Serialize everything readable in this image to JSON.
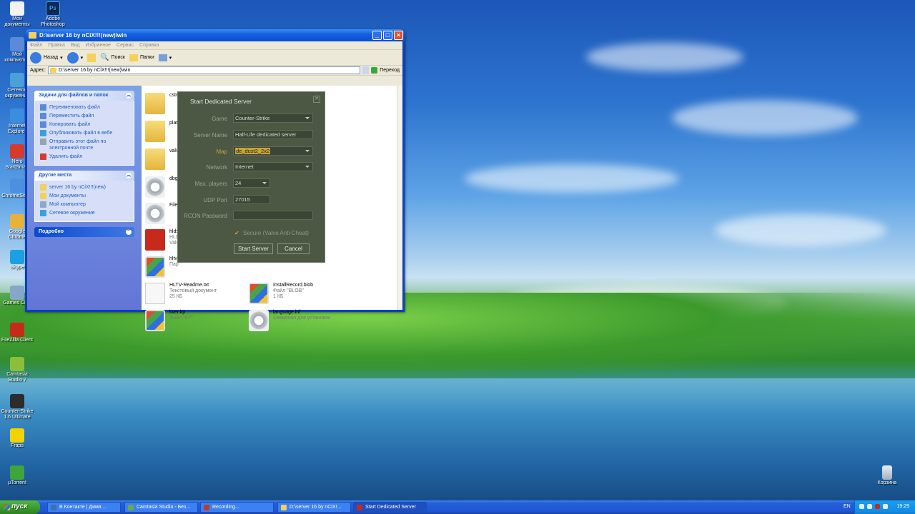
{
  "desktop": {
    "icons_left": [
      {
        "label": "Мои документы",
        "icon": "my-documents-icon"
      },
      {
        "label": "Мой компьютер",
        "icon": "my-computer-icon"
      },
      {
        "label": "Сетевое окружение",
        "icon": "network-icon"
      },
      {
        "label": "Internet Explorer",
        "icon": "ie-icon"
      },
      {
        "label": "Nero StartSmart",
        "icon": "nero-icon"
      },
      {
        "label": "ChromeSetup",
        "icon": "chrome-setup-icon"
      },
      {
        "label": "Google Chrome",
        "icon": "chrome-icon"
      },
      {
        "label": "Skype",
        "icon": "skype-icon"
      },
      {
        "label": "Games CPU",
        "icon": "cpu-icon"
      },
      {
        "label": "FileZilla Client",
        "icon": "filezilla-icon"
      },
      {
        "label": "Camtasia Studio 7",
        "icon": "camtasia-icon"
      },
      {
        "label": "Counter-Strike 1.6 Ultimate",
        "icon": "counter-strike-icon"
      },
      {
        "label": "Fraps",
        "icon": "fraps-icon"
      },
      {
        "label": "µTorrent",
        "icon": "utorrent-icon"
      }
    ],
    "photoshop_label": "Adobe Photoshop",
    "recycle_bin_label": "Корзина"
  },
  "explorer": {
    "title": "D:\\server 16 by nCiX!!!(new)\\win",
    "menu": [
      "Файл",
      "Правка",
      "Вид",
      "Избранное",
      "Сервис",
      "Справка"
    ],
    "toolbar": {
      "back": "Назад",
      "search": "Поиск",
      "folders": "Папки"
    },
    "address_label": "Адрес:",
    "address_value": "D:\\server 16 by nCiX!!!(new)\\win",
    "go_label": "Переход",
    "tasks_panel": {
      "title": "Задачи для файлов и папок",
      "items": [
        "Переименовать файл",
        "Переместить файл",
        "Копировать файл",
        "Опубликовать файл в вебе",
        "Отправить этот файл по электронной почте",
        "Удалить файл"
      ]
    },
    "places_panel": {
      "title": "Другие места",
      "items": [
        "server 16 by nCiX!!!(new)",
        "Мои документы",
        "Мой компьютер",
        "Сетевое окружение"
      ]
    },
    "details_panel": {
      "title": "Подробно"
    },
    "files": [
      {
        "name": "cstr"
      },
      {
        "name": "plat"
      },
      {
        "name": "valv"
      },
      {
        "name": "dbg"
      },
      {
        "name": "File"
      },
      {
        "name": "hlds",
        "line2": "HLD",
        "line3": "Valv"
      },
      {
        "name": "hltv",
        "line2": "Пар"
      },
      {
        "name": "HLTV-Readme.txt",
        "line2": "Текстовый документ",
        "line3": "25 КБ"
      },
      {
        "name": "InstallRecord.blob",
        "line2": "Файл \"BLOB\"",
        "line3": "1 КБ"
      },
      {
        "name": "kver.kp",
        "line2": "Файл \"KP\""
      },
      {
        "name": "language.inf",
        "line2": "Сведения для установки"
      }
    ]
  },
  "dialog": {
    "title": "Start Dedicated Server",
    "game_label": "Game",
    "game_value": "Counter-Strike",
    "server_name_label": "Server Name",
    "server_name_value": "Half-Life dedicated server",
    "map_label": "Map",
    "map_value": "de_dust2_2x2",
    "network_label": "Network",
    "network_value": "Internet",
    "max_players_label": "Max. players",
    "max_players_value": "24",
    "udp_port_label": "UDP Port",
    "udp_port_value": "27015",
    "rcon_label": "RCON Password",
    "rcon_value": "",
    "secure_label": "Secure (Valve Anti-Cheat)",
    "start_button": "Start Server",
    "cancel_button": "Cancel"
  },
  "taskbar": {
    "start_label": "пуск",
    "tasks": [
      {
        "label": "В Контакте | Дима ...",
        "color": "#3b6fb0"
      },
      {
        "label": "Camtasia Studio - Без...",
        "color": "#6aa84f"
      },
      {
        "label": "Recording...",
        "color": "#c0392b"
      },
      {
        "label": "D:\\server 16 by nCiX!...",
        "color": "#f3d15a"
      },
      {
        "label": "Start Dedicated Server",
        "color": "#c72a1c"
      }
    ],
    "lang": "EN",
    "clock": "19:29"
  }
}
